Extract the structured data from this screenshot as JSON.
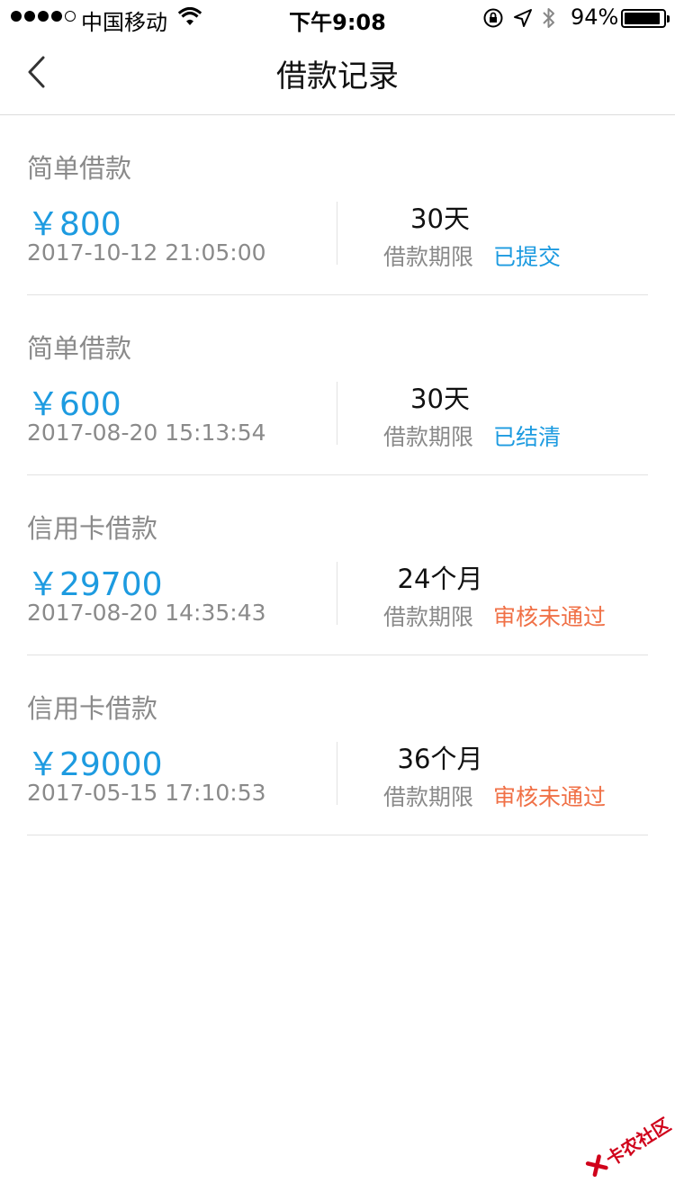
{
  "status_bar": {
    "carrier": "中国移动",
    "time": "下午9:08",
    "battery": "94%",
    "battery_level": 0.94
  },
  "nav": {
    "title": "借款记录"
  },
  "records": [
    {
      "type": "简单借款",
      "amount": "￥800",
      "date": "2017-10-12 21:05:00",
      "term": "30天",
      "term_label": "借款期限",
      "status": "已提交",
      "status_color": "#1d9be0"
    },
    {
      "type": "简单借款",
      "amount": "￥600",
      "date": "2017-08-20 15:13:54",
      "term": "30天",
      "term_label": "借款期限",
      "status": "已结清",
      "status_color": "#1d9be0"
    },
    {
      "type": "信用卡借款",
      "amount": "￥29700",
      "date": "2017-08-20 14:35:43",
      "term": "24个月",
      "term_label": "借款期限",
      "status": "审核未通过",
      "status_color": "#f07046"
    },
    {
      "type": "信用卡借款",
      "amount": "￥29000",
      "date": "2017-05-15 17:10:53",
      "term": "36个月",
      "term_label": "借款期限",
      "status": "审核未通过",
      "status_color": "#f07046"
    }
  ],
  "watermark": {
    "text": "卡农社区"
  },
  "colors": {
    "accent": "#1d9be0",
    "rejected": "#f07046",
    "muted_text": "#8a8a8a"
  }
}
